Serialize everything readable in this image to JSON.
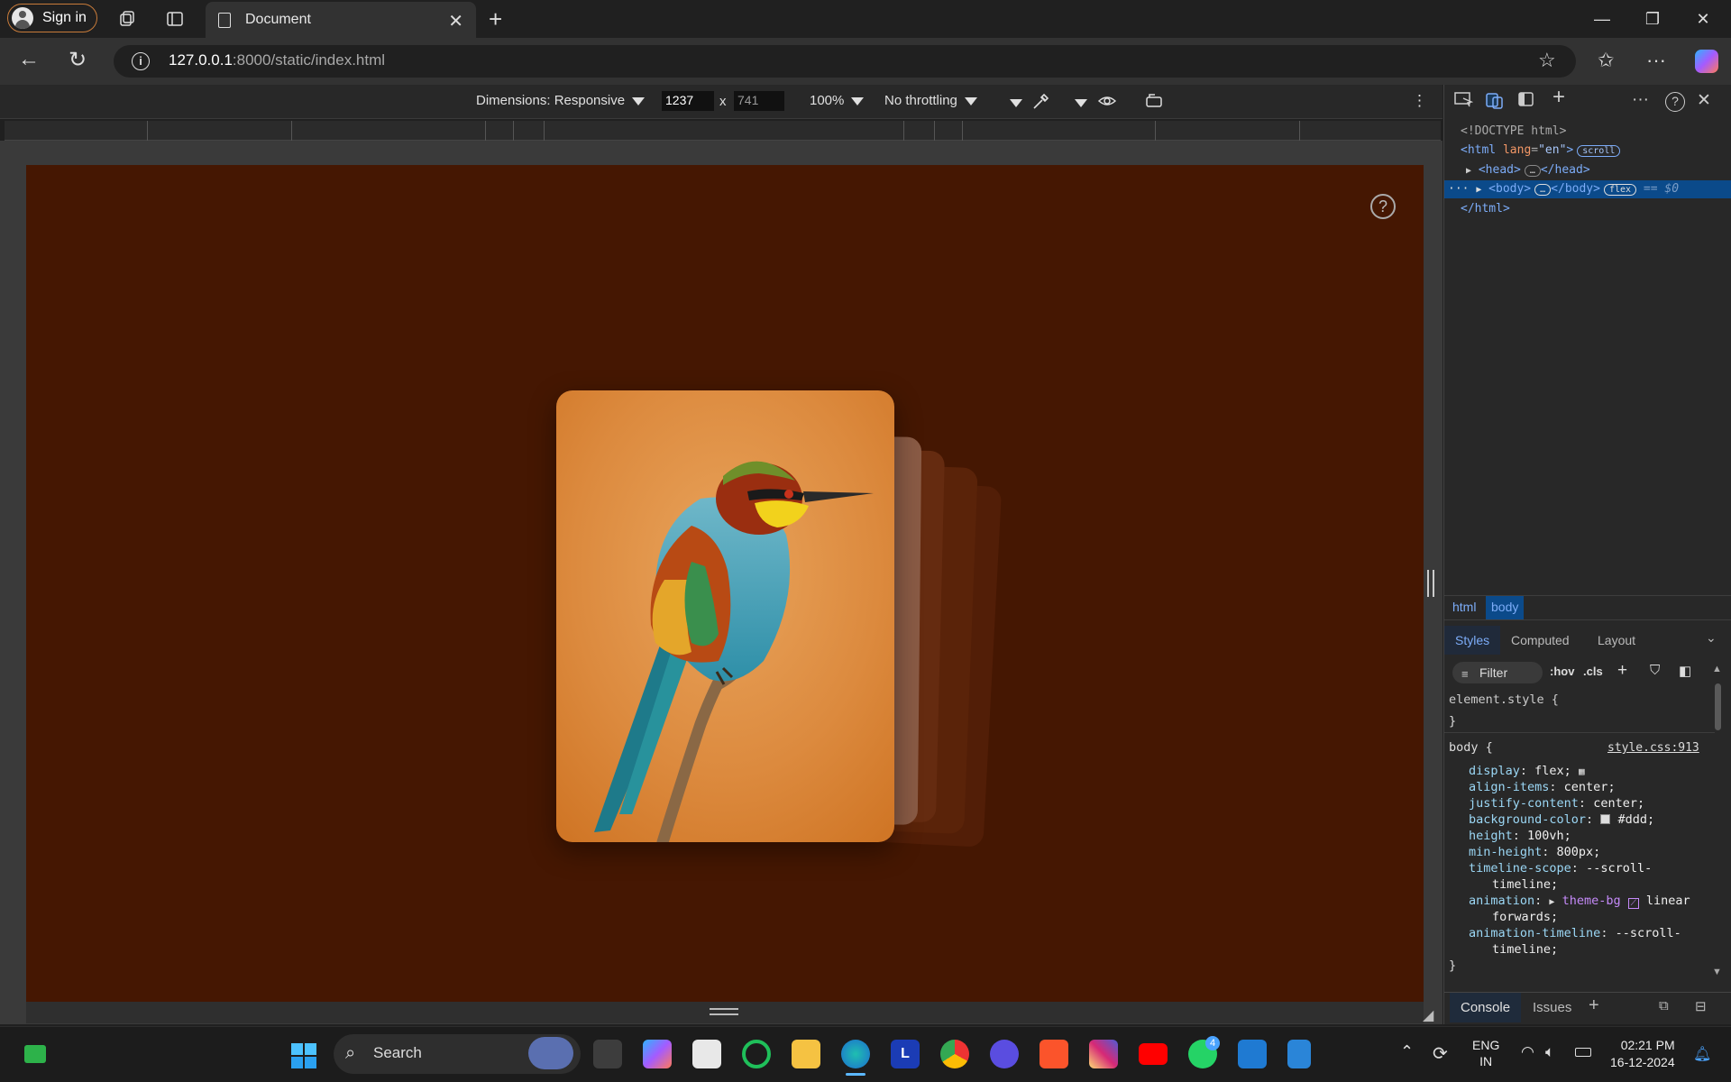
{
  "browser": {
    "sign_in_label": "Sign in",
    "tab_title": "Document",
    "url_host": "127.0.0.1",
    "url_rest": ":8000/static/index.html"
  },
  "device_toolbar": {
    "dimensions_label": "Dimensions: Responsive",
    "width": "1237",
    "height": "741",
    "times": "x",
    "zoom": "100%",
    "throttling": "No throttling"
  },
  "page": {
    "background": "#451702",
    "help_symbol": "?"
  },
  "devtools": {
    "dom": {
      "doctype": "<!DOCTYPE html>",
      "html_open": "<html",
      "html_attr": "lang",
      "html_attr_value": "\"en\"",
      "html_close": ">",
      "scroll_badge": "scroll",
      "head": "<head>",
      "head_close": "</head>",
      "body": "<body>",
      "body_close": "</body>",
      "flex_badge": "flex",
      "eq": "== $0",
      "html_end": "</html>"
    },
    "breadcrumbs": [
      "html",
      "body"
    ],
    "panel_tabs": [
      "Styles",
      "Computed",
      "Layout"
    ],
    "filter_label": "Filter",
    "hov": ":hov",
    "cls": ".cls",
    "element_style": "element.style {",
    "brace_close": "}",
    "selector": "body {",
    "source": "style.css:913",
    "rules": [
      {
        "prop": "display",
        "val": "flex;"
      },
      {
        "prop": "align-items",
        "val": "center;"
      },
      {
        "prop": "justify-content",
        "val": "center;"
      },
      {
        "prop": "background-color",
        "val": "#ddd;"
      },
      {
        "prop": "height",
        "val": "100vh;"
      },
      {
        "prop": "min-height",
        "val": "800px;"
      },
      {
        "prop": "timeline-scope",
        "val": "--scroll-"
      },
      {
        "prop": "",
        "val": "timeline;"
      },
      {
        "prop": "animation",
        "val": "theme-bg"
      },
      {
        "prop": "",
        "val": "forwards;"
      },
      {
        "prop": "animation-timeline",
        "val": "--scroll-"
      },
      {
        "prop": "",
        "val": "timeline;"
      }
    ],
    "animation_linear": "linear",
    "drawer_tabs": [
      "Console",
      "Issues"
    ]
  },
  "taskbar": {
    "search_label": "Search",
    "whatsapp_badge": "4",
    "lang_1": "ENG",
    "lang_2": "IN",
    "time": "02:21 PM",
    "date": "16-12-2024"
  },
  "icons": [
    "user-avatar-icon",
    "workspaces-icon",
    "tab-actions-icon",
    "document-icon",
    "close-icon",
    "plus-icon",
    "minimize-icon",
    "restore-icon",
    "back-icon",
    "reload-icon",
    "info-icon",
    "star-icon",
    "favorites-icon",
    "more-icon",
    "copilot-icon",
    "help-icon",
    "eyedropper-icon",
    "eye-icon",
    "windows-start-icon",
    "search-icon"
  ]
}
